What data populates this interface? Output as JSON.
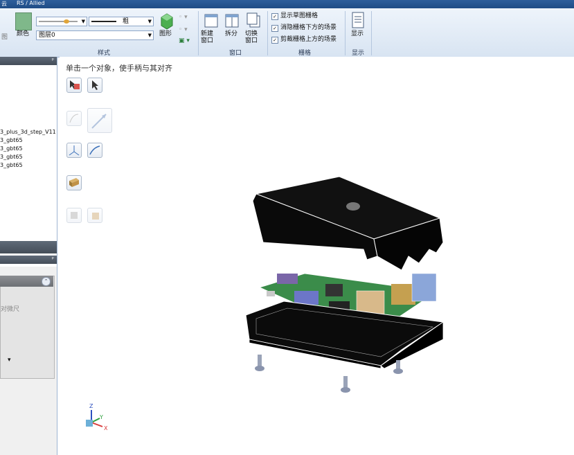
{
  "titlebar": {
    "left_text": "云",
    "tab": "RS / Allied"
  },
  "ribbon": {
    "style_group": {
      "color_label": "颜色",
      "line_weight_label": "粗",
      "layer_label": "图层",
      "layer_value": "图层0",
      "shape_label": "图形",
      "group_label": "样式"
    },
    "window_group": {
      "new_window": "新建\n窗口",
      "split": "拆分",
      "switch_window": "切换\n窗口",
      "group_label": "窗口"
    },
    "grid_group": {
      "options": [
        {
          "label": "显示草图栅格",
          "checked": true
        },
        {
          "label": "消隐栅格下方的场景",
          "checked": true
        },
        {
          "label": "剪裁栅格上方的场景",
          "checked": true
        }
      ],
      "group_label": "栅格"
    },
    "display_group": {
      "display": "显示",
      "group_label": "显示"
    },
    "left_cut": {
      "a": "图",
      "b": "显示"
    }
  },
  "left_panel": {
    "tree_items": [
      "3_plus_3d_step_V11",
      "3_gbt65",
      "3_gbt65",
      "3_gbt65",
      "3_gbt65"
    ],
    "sub_label": "对微尺"
  },
  "viewport": {
    "instruction": "单击一个对象，使手柄与其对齐",
    "axes": {
      "z": "Z",
      "y": "Y",
      "x": "X"
    }
  },
  "colors": {
    "accent": "#1f4c86",
    "ribbon": "#dbe6f3",
    "panel_header": "#4f5864"
  }
}
